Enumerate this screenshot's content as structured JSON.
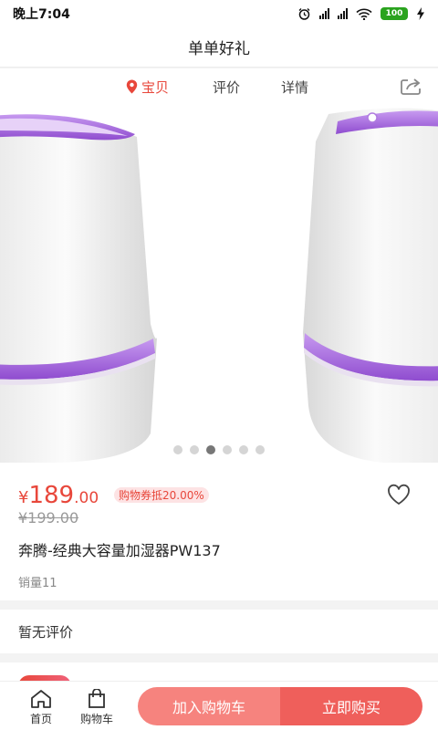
{
  "status_bar": {
    "time": "晚上7:04",
    "battery": "100"
  },
  "header": {
    "title": "单单好礼"
  },
  "tabs": [
    {
      "label": "宝贝",
      "icon": "location-pin-icon",
      "active": true
    },
    {
      "label": "评价",
      "active": false
    },
    {
      "label": "详情",
      "active": false
    }
  ],
  "carousel": {
    "image_count": 6,
    "active_index": 2
  },
  "product": {
    "currency": "¥",
    "price_int": "189",
    "price_dec": ".00",
    "coupon": "购物券抵20.00%",
    "original_price": "¥199.00",
    "title": "奔腾-经典大容量加湿器PW137",
    "sales": "销量11"
  },
  "reviews": {
    "empty_text": "暂无评价"
  },
  "bottom_nav": {
    "home_label": "首页",
    "cart_label": "购物车",
    "add_to_cart": "加入购物车",
    "buy_now": "立即购买"
  },
  "colors": {
    "accent": "#e8473b",
    "product_purple": "#a15cde",
    "cart_button": "#f6837e",
    "buy_button": "#ef5f5b"
  }
}
